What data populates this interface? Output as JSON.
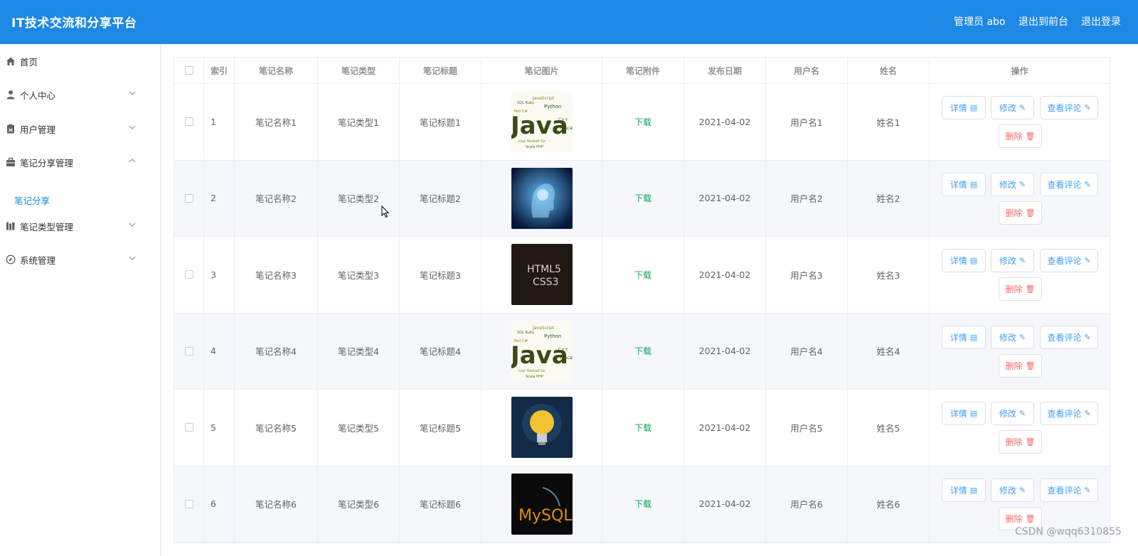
{
  "header": {
    "title": "IT技术交流和分享平台",
    "user": "管理员 abo",
    "to_front": "退出到前台",
    "logout": "退出登录"
  },
  "sidebar": {
    "items": [
      {
        "label": "首页",
        "icon": "home-icon",
        "expandable": false
      },
      {
        "label": "个人中心",
        "icon": "user-icon",
        "expandable": true
      },
      {
        "label": "用户管理",
        "icon": "clipboard-icon",
        "expandable": true
      },
      {
        "label": "笔记分享管理",
        "icon": "briefcase-icon",
        "expandable": true,
        "expanded": true
      },
      {
        "label": "笔记类型管理",
        "icon": "library-icon",
        "expandable": true
      },
      {
        "label": "系统管理",
        "icon": "compass-icon",
        "expandable": true
      }
    ],
    "active_sub": "笔记分享"
  },
  "table": {
    "headers": [
      "索引",
      "笔记名称",
      "笔记类型",
      "笔记标题",
      "笔记图片",
      "笔记附件",
      "发布日期",
      "用户名",
      "姓名",
      "操作"
    ],
    "rows": [
      {
        "index": "1",
        "name": "笔记名称1",
        "type": "笔记类型1",
        "title": "笔记标题1",
        "image": "java-wordcloud",
        "attachment": "下载",
        "date": "2021-04-02",
        "username": "用户名1",
        "realname": "姓名1"
      },
      {
        "index": "2",
        "name": "笔记名称2",
        "type": "笔记类型2",
        "title": "笔记标题2",
        "image": "ai-head",
        "attachment": "下载",
        "date": "2021-04-02",
        "username": "用户名2",
        "realname": "姓名2"
      },
      {
        "index": "3",
        "name": "笔记名称3",
        "type": "笔记类型3",
        "title": "笔记标题3",
        "image": "html5-css3",
        "attachment": "下载",
        "date": "2021-04-02",
        "username": "用户名3",
        "realname": "姓名3"
      },
      {
        "index": "4",
        "name": "笔记名称4",
        "type": "笔记类型4",
        "title": "笔记标题4",
        "image": "java-wordcloud",
        "attachment": "下载",
        "date": "2021-04-02",
        "username": "用户名4",
        "realname": "姓名4"
      },
      {
        "index": "5",
        "name": "笔记名称5",
        "type": "笔记类型5",
        "title": "笔记标题5",
        "image": "lightbulb",
        "attachment": "下载",
        "date": "2021-04-02",
        "username": "用户名5",
        "realname": "姓名5"
      },
      {
        "index": "6",
        "name": "笔记名称6",
        "type": "笔记类型6",
        "title": "笔记标题6",
        "image": "mysql-logo",
        "attachment": "下载",
        "date": "2021-04-02",
        "username": "用户名6",
        "realname": "姓名6"
      }
    ],
    "actions": {
      "detail": "详情",
      "edit": "修改",
      "comments": "查看评论",
      "delete": "删除"
    }
  },
  "thumb_text": {
    "java": "Java",
    "html5": "HTML5",
    "css3": "CSS3",
    "mysql": "MySQL"
  },
  "watermark": "CSDN @wqq6310855",
  "colors": {
    "header_bg": "#1e88e5",
    "accent": "#409eff",
    "download": "#18a05e",
    "danger": "#f56c6c"
  }
}
